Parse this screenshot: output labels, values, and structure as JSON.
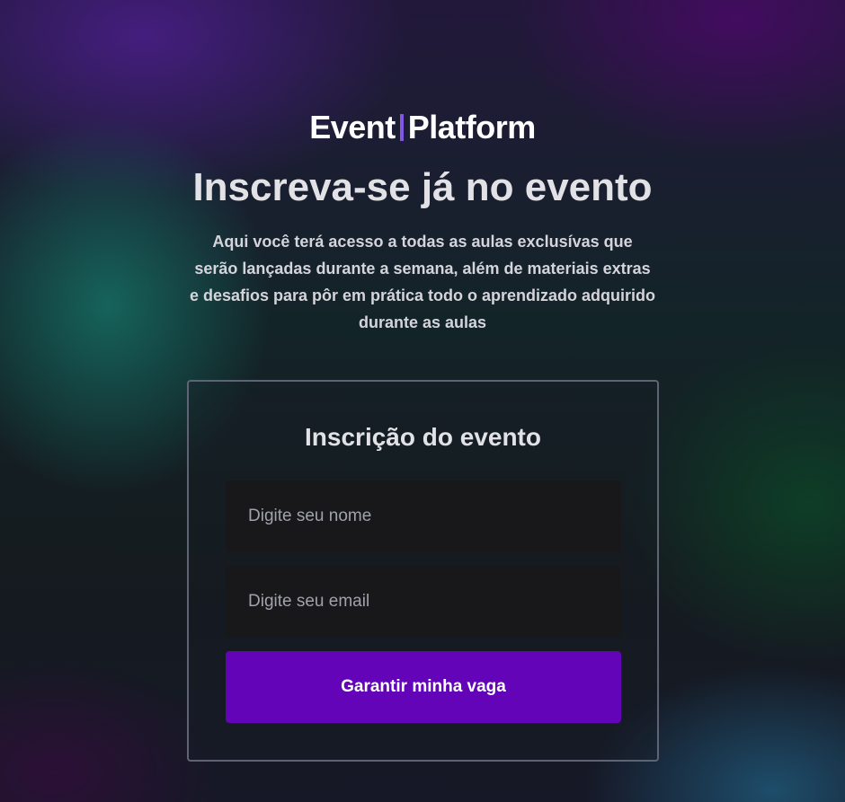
{
  "logo": {
    "part1": "Event",
    "part2": "Platform"
  },
  "hero": {
    "title": "Inscreva-se já no evento",
    "description": "Aqui você terá acesso a todas as aulas exclusívas que serão lançadas durante a semana, além de materiais extras e desafios para pôr em prática todo o aprendizado adquirido durante as aulas"
  },
  "form": {
    "title": "Inscrição do evento",
    "name_placeholder": "Digite seu nome",
    "name_value": "",
    "email_placeholder": "Digite seu email",
    "email_value": "",
    "submit_label": "Garantir minha vaga"
  },
  "colors": {
    "accent": "#8257e5",
    "button": "#6304b8",
    "input_bg": "#18181a",
    "text": "#e1e1e6"
  }
}
